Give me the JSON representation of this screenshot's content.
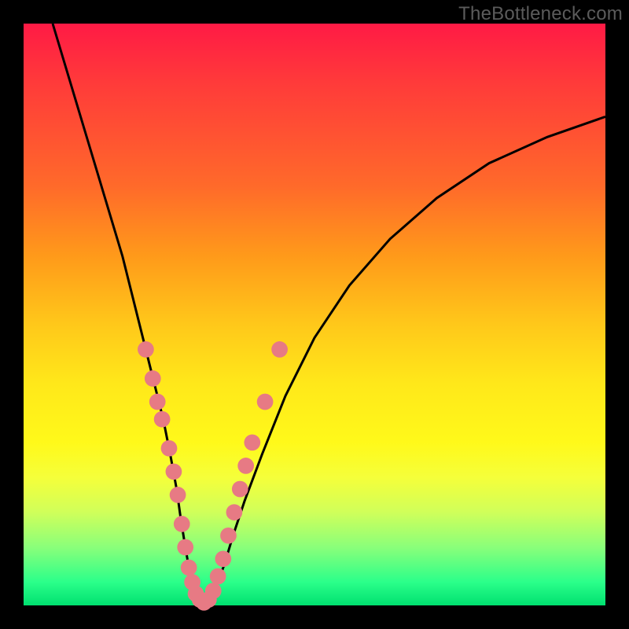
{
  "watermark": "TheBottleneck.com",
  "colors": {
    "background": "#000000",
    "curve": "#000000",
    "markers": "#e77a84",
    "gradient_top": "#ff1a45",
    "gradient_bottom": "#00e070"
  },
  "chart_data": {
    "type": "line",
    "title": "",
    "xlabel": "",
    "ylabel": "",
    "xlim": [
      0,
      100
    ],
    "ylim": [
      0,
      100
    ],
    "grid": false,
    "legend": false,
    "series": [
      {
        "name": "bottleneck-curve",
        "x": [
          5,
          8,
          11,
          14,
          17,
          19,
          21,
          22.5,
          24,
          25.2,
          26.3,
          27,
          27.8,
          28.5,
          29.2,
          30,
          31,
          32,
          33,
          34.5,
          36,
          38,
          41,
          45,
          50,
          56,
          63,
          71,
          80,
          90,
          100
        ],
        "y": [
          100,
          90,
          80,
          70,
          60,
          52,
          44,
          38,
          32,
          26,
          20,
          15,
          10,
          6,
          3,
          1,
          0.5,
          1,
          3,
          7,
          12,
          18,
          26,
          36,
          46,
          55,
          63,
          70,
          76,
          80.5,
          84
        ]
      }
    ],
    "markers": {
      "name": "highlighted-points",
      "color": "#e77a84",
      "radius_pct": 1.4,
      "points": [
        {
          "x": 21.0,
          "y": 44
        },
        {
          "x": 22.2,
          "y": 39
        },
        {
          "x": 23.0,
          "y": 35
        },
        {
          "x": 23.8,
          "y": 32
        },
        {
          "x": 25.0,
          "y": 27
        },
        {
          "x": 25.8,
          "y": 23
        },
        {
          "x": 26.5,
          "y": 19
        },
        {
          "x": 27.2,
          "y": 14
        },
        {
          "x": 27.8,
          "y": 10
        },
        {
          "x": 28.4,
          "y": 6.5
        },
        {
          "x": 29.0,
          "y": 4
        },
        {
          "x": 29.6,
          "y": 2
        },
        {
          "x": 30.3,
          "y": 1
        },
        {
          "x": 31.0,
          "y": 0.5
        },
        {
          "x": 31.8,
          "y": 1
        },
        {
          "x": 32.6,
          "y": 2.5
        },
        {
          "x": 33.4,
          "y": 5
        },
        {
          "x": 34.3,
          "y": 8
        },
        {
          "x": 35.2,
          "y": 12
        },
        {
          "x": 36.2,
          "y": 16
        },
        {
          "x": 37.2,
          "y": 20
        },
        {
          "x": 38.2,
          "y": 24
        },
        {
          "x": 39.3,
          "y": 28
        },
        {
          "x": 41.5,
          "y": 35
        },
        {
          "x": 44.0,
          "y": 44
        }
      ]
    }
  }
}
